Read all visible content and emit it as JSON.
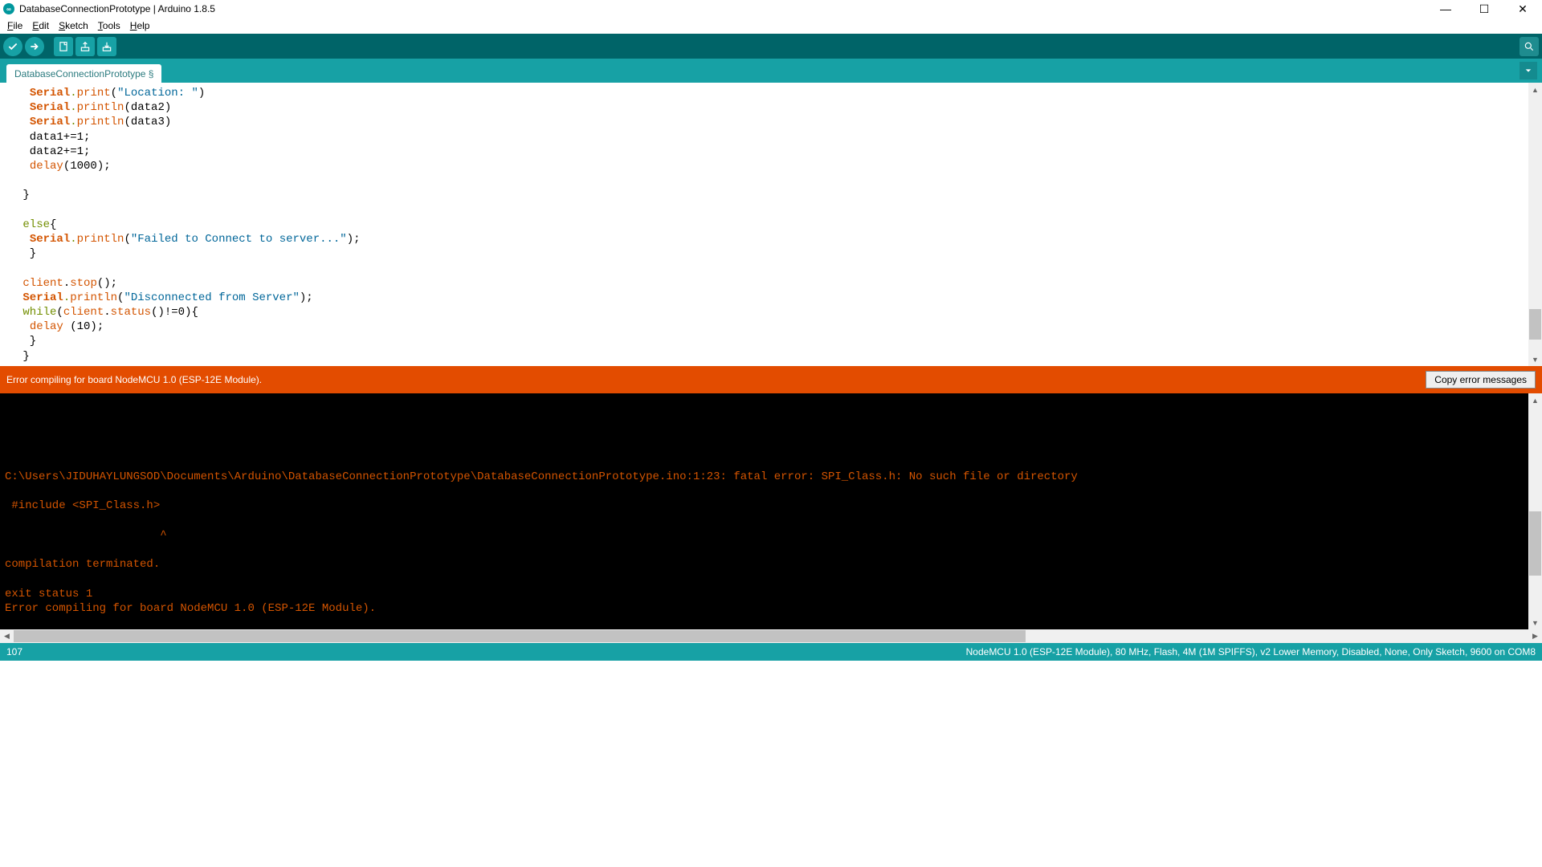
{
  "title_bar": {
    "label": "DatabaseConnectionPrototype | Arduino 1.8.5",
    "app_icon_text": "∞"
  },
  "menu": {
    "file": "File",
    "edit": "Edit",
    "sketch": "Sketch",
    "tools": "Tools",
    "help": "Help"
  },
  "tab": {
    "label": "DatabaseConnectionPrototype §"
  },
  "code": {
    "lines": [
      {
        "indent": "  ",
        "tokens": [
          {
            "t": "Serial",
            "c": "tok-kw1"
          },
          {
            "t": ".",
            "c": "tok-dot"
          },
          {
            "t": "print",
            "c": "tok-kw2"
          },
          {
            "t": "("
          },
          {
            "t": "\"Location: \"",
            "c": "tok-str"
          },
          {
            "t": ")"
          }
        ]
      },
      {
        "indent": "  ",
        "tokens": [
          {
            "t": "Serial",
            "c": "tok-kw1"
          },
          {
            "t": ".",
            "c": "tok-dot"
          },
          {
            "t": "println",
            "c": "tok-kw2"
          },
          {
            "t": "(data2)"
          }
        ]
      },
      {
        "indent": "  ",
        "tokens": [
          {
            "t": "Serial",
            "c": "tok-kw1"
          },
          {
            "t": ".",
            "c": "tok-dot"
          },
          {
            "t": "println",
            "c": "tok-kw2"
          },
          {
            "t": "(data3)"
          }
        ]
      },
      {
        "indent": "  ",
        "tokens": [
          {
            "t": "data1+=1;"
          }
        ]
      },
      {
        "indent": "  ",
        "tokens": [
          {
            "t": "data2+=1;"
          }
        ]
      },
      {
        "indent": "  ",
        "tokens": [
          {
            "t": "delay",
            "c": "tok-kw2"
          },
          {
            "t": "(1000);"
          }
        ]
      },
      {
        "indent": "",
        "tokens": [
          {
            "t": " "
          }
        ]
      },
      {
        "indent": " ",
        "tokens": [
          {
            "t": "}"
          }
        ]
      },
      {
        "indent": "",
        "tokens": [
          {
            "t": " "
          }
        ]
      },
      {
        "indent": " ",
        "tokens": [
          {
            "t": "else",
            "c": "tok-kw3"
          },
          {
            "t": "{"
          }
        ]
      },
      {
        "indent": "  ",
        "tokens": [
          {
            "t": "Serial",
            "c": "tok-kw1"
          },
          {
            "t": ".",
            "c": "tok-dot"
          },
          {
            "t": "println",
            "c": "tok-kw2"
          },
          {
            "t": "("
          },
          {
            "t": "\"Failed to Connect to server...\"",
            "c": "tok-str"
          },
          {
            "t": ");"
          }
        ]
      },
      {
        "indent": "  ",
        "tokens": [
          {
            "t": "}"
          }
        ]
      },
      {
        "indent": "",
        "tokens": [
          {
            "t": " "
          }
        ]
      },
      {
        "indent": " ",
        "tokens": [
          {
            "t": "client",
            "c": "tok-kw2"
          },
          {
            "t": "."
          },
          {
            "t": "stop",
            "c": "tok-kw2"
          },
          {
            "t": "();"
          }
        ]
      },
      {
        "indent": " ",
        "tokens": [
          {
            "t": "Serial",
            "c": "tok-kw1"
          },
          {
            "t": ".",
            "c": "tok-dot"
          },
          {
            "t": "println",
            "c": "tok-kw2"
          },
          {
            "t": "("
          },
          {
            "t": "\"Disconnected from Server\"",
            "c": "tok-str"
          },
          {
            "t": ");"
          }
        ]
      },
      {
        "indent": " ",
        "tokens": [
          {
            "t": "while",
            "c": "tok-kw3"
          },
          {
            "t": "("
          },
          {
            "t": "client",
            "c": "tok-kw2"
          },
          {
            "t": "."
          },
          {
            "t": "status",
            "c": "tok-kw2"
          },
          {
            "t": "()!=0){"
          }
        ]
      },
      {
        "indent": "  ",
        "tokens": [
          {
            "t": "delay",
            "c": "tok-kw2"
          },
          {
            "t": " (10);"
          }
        ]
      },
      {
        "indent": "  ",
        "tokens": [
          {
            "t": "}"
          }
        ]
      },
      {
        "indent": " ",
        "tokens": [
          {
            "t": "}"
          }
        ]
      }
    ]
  },
  "status": {
    "message": "Error compiling for board NodeMCU 1.0 (ESP-12E Module).",
    "copy_label": "Copy error messages"
  },
  "console": {
    "lines": [
      "",
      "",
      "",
      "",
      "",
      "C:\\Users\\JIDUHAYLUNGSOD\\Documents\\Arduino\\DatabaseConnectionPrototype\\DatabaseConnectionPrototype.ino:1:23: fatal error: SPI_Class.h: No such file or directory",
      "",
      " #include <SPI_Class.h>",
      "",
      "                       ^",
      "",
      "compilation terminated.",
      "",
      "exit status 1",
      "Error compiling for board NodeMCU 1.0 (ESP-12E Module)."
    ]
  },
  "footer": {
    "line_no": "107",
    "board_info": "NodeMCU 1.0 (ESP-12E Module), 80 MHz, Flash, 4M (1M SPIFFS), v2 Lower Memory, Disabled, None, Only Sketch, 9600 on COM8"
  }
}
